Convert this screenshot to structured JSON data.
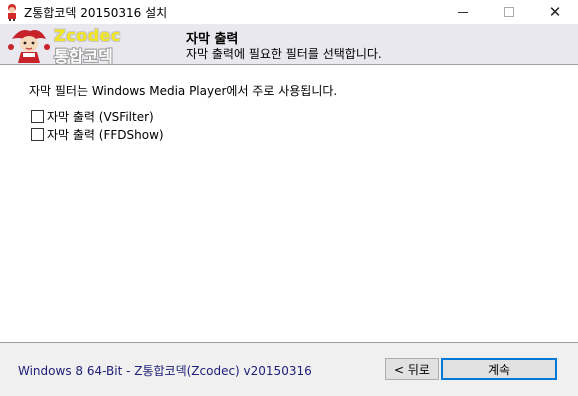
{
  "window": {
    "title": "Z통합코덱 20150316 설치"
  },
  "header": {
    "logo_line1": "Zcodec",
    "logo_line2": "통합코덱",
    "title": "자막 출력",
    "subtitle": "자막 출력에 필요한 필터를 선택합니다."
  },
  "content": {
    "description": "자막 필터는  Windows Media Player에서 주로 사용됩니다.",
    "options": [
      {
        "label": "자막 출력 (VSFilter)",
        "checked": false
      },
      {
        "label": "자막 출력 (FFDShow)",
        "checked": false
      }
    ]
  },
  "footer": {
    "version_text": "Windows 8 64-Bit - Z통합코덱(Zcodec) v20150316",
    "back_label": "< 뒤로",
    "next_label": "계속"
  },
  "colors": {
    "header_bg": "#e8e8ee",
    "footer_text": "#20207a",
    "focus_border": "#0078d7",
    "logo_yellow": "#f2e61e"
  }
}
